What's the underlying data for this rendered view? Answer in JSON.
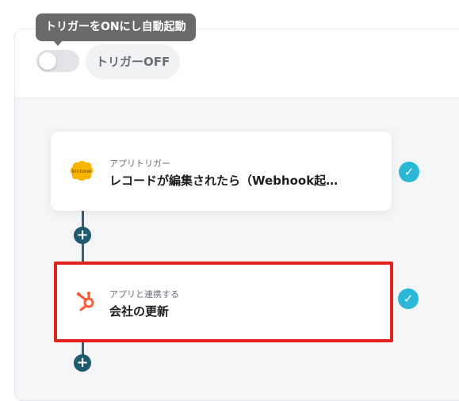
{
  "trigger": {
    "tooltip": "トリガーをONにし自動起動",
    "status_label": "トリガーOFF"
  },
  "flow": {
    "add_symbol": "+",
    "check_symbol": "✓",
    "steps": [
      {
        "category": "アプリトリガー",
        "title": "レコードが編集されたら（Webhook起…",
        "app_icon": "kintone-icon",
        "logo_text": "kintone"
      },
      {
        "category": "アプリと連携する",
        "title": "会社の更新",
        "app_icon": "hubspot-icon"
      }
    ]
  },
  "colors": {
    "connector": "#2f6378",
    "check": "#2bb8d6",
    "highlight": "#e3211f",
    "kintone": "#f7b500",
    "hubspot": "#ff5c35"
  }
}
